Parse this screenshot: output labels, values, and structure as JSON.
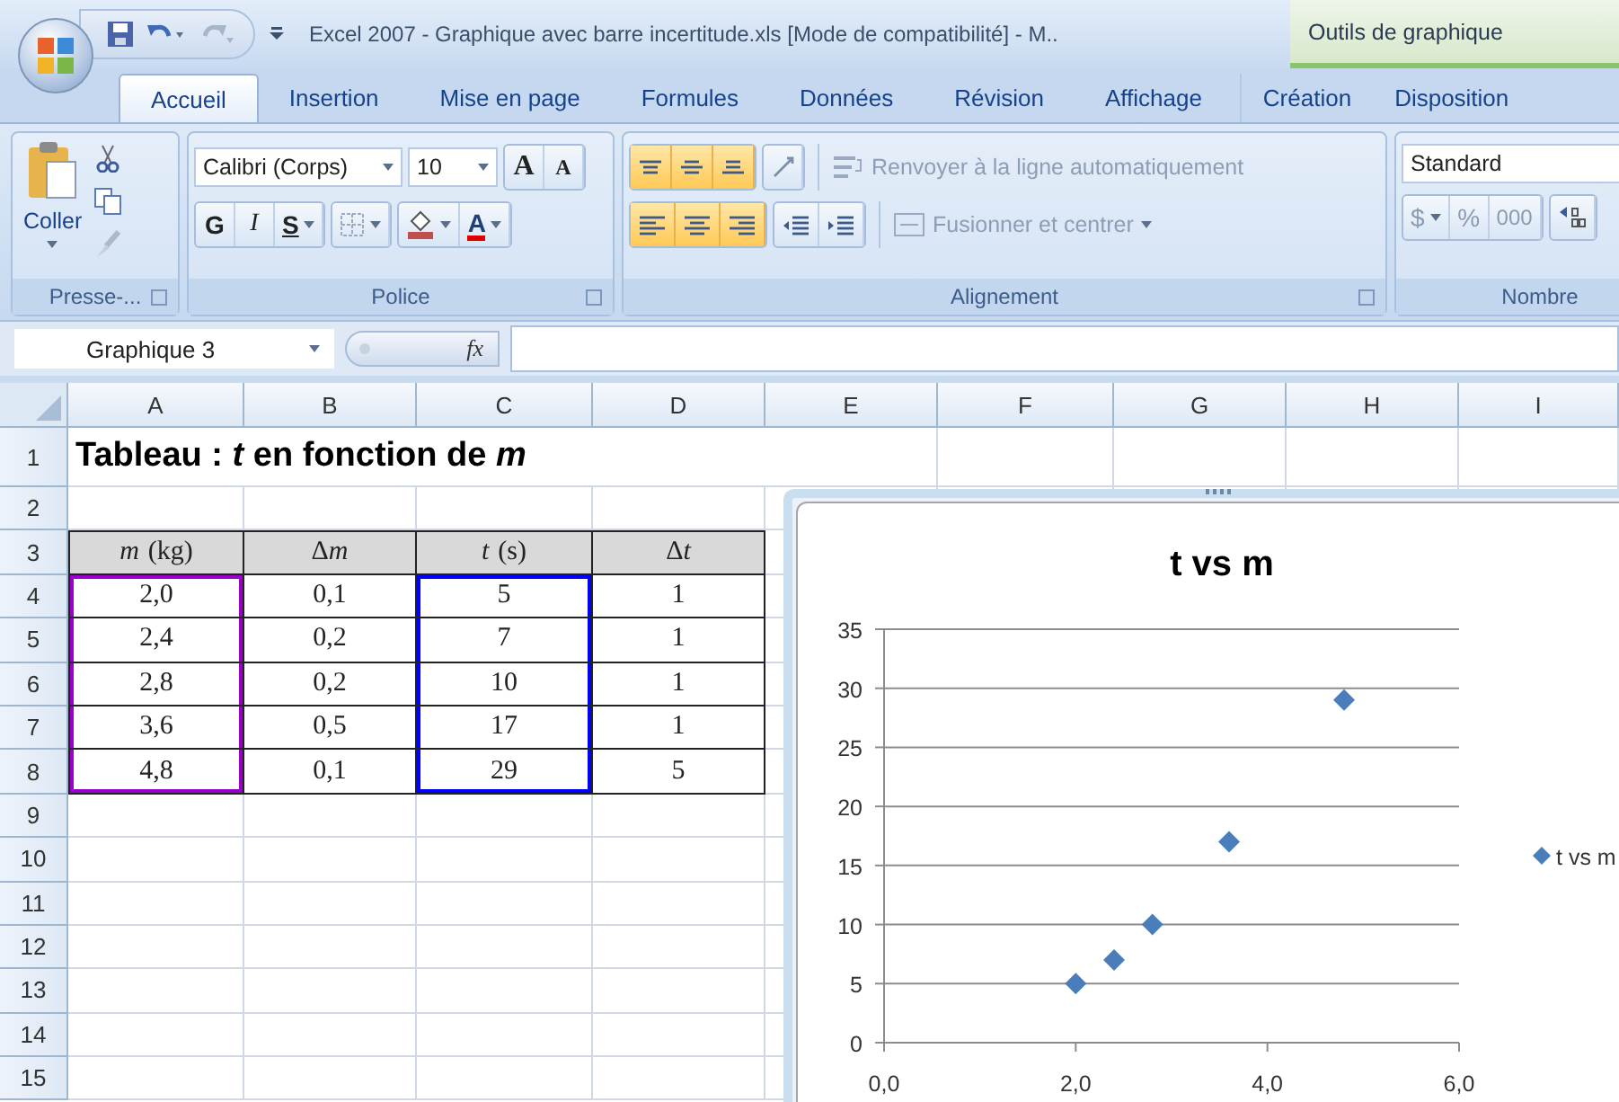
{
  "title_bar": {
    "title": "Excel 2007 - Graphique avec barre incertitude.xls  [Mode de compatibilité] - M..",
    "contextual_label": "Outils de graphique"
  },
  "tabs": [
    {
      "label": "Accueil",
      "selected": true,
      "kind": "main"
    },
    {
      "label": "Insertion",
      "selected": false,
      "kind": "main"
    },
    {
      "label": "Mise en page",
      "selected": false,
      "kind": "main"
    },
    {
      "label": "Formules",
      "selected": false,
      "kind": "main"
    },
    {
      "label": "Données",
      "selected": false,
      "kind": "main"
    },
    {
      "label": "Révision",
      "selected": false,
      "kind": "main"
    },
    {
      "label": "Affichage",
      "selected": false,
      "kind": "main"
    },
    {
      "label": "Création",
      "selected": false,
      "kind": "contextual"
    },
    {
      "label": "Disposition",
      "selected": false,
      "kind": "contextual"
    }
  ],
  "ribbon": {
    "clipboard": {
      "paste_label": "Coller",
      "group_label": "Presse-..."
    },
    "font": {
      "font_name": "Calibri (Corps)",
      "font_size": "10",
      "grow": "A",
      "shrink": "A",
      "bold": "G",
      "italic": "I",
      "underline": "S",
      "font_color": "A",
      "group_label": "Police"
    },
    "alignment": {
      "vertical_buttons": [
        {
          "kind": "top",
          "selected": true
        },
        {
          "kind": "middle",
          "selected": true
        },
        {
          "kind": "bottom",
          "selected": true
        },
        {
          "kind": "orientation",
          "selected": false
        }
      ],
      "horizontal_buttons": [
        {
          "kind": "left",
          "selected": true
        },
        {
          "kind": "center",
          "selected": true
        },
        {
          "kind": "right",
          "selected": true
        },
        {
          "kind": "outdent",
          "selected": false
        },
        {
          "kind": "indent",
          "selected": false
        }
      ],
      "wrap_text": {
        "label": "Renvoyer à la ligne automatiquement",
        "disabled": true
      },
      "merge": {
        "label": "Fusionner et centrer",
        "disabled": true
      },
      "group_label": "Alignement"
    },
    "number": {
      "format": "Standard",
      "currency": "$",
      "percent": "%",
      "thousands": "000",
      "group_label": "Nombre"
    }
  },
  "formula_bar": {
    "name_box": "Graphique 3",
    "function_symbol": "fx"
  },
  "sheet": {
    "columns": [
      "A",
      "B",
      "C",
      "D",
      "E",
      "F",
      "G",
      "H",
      "I"
    ],
    "rows": [
      {
        "number": "1",
        "kind": "title",
        "text": "Tableau : *t*  en fonction de *m*"
      },
      {
        "number": "2",
        "kind": "empty"
      },
      {
        "number": "3",
        "kind": "header",
        "cells": [
          {
            "variable": "m",
            "unit": "(kg)",
            "color": "#9900cc"
          },
          {
            "prefix": "Δ",
            "variable": "m"
          },
          {
            "variable": "t",
            "unit": "(s)",
            "color": "#0000ff"
          },
          {
            "prefix": "Δ",
            "variable": "t"
          }
        ]
      },
      {
        "number": "4",
        "kind": "data",
        "cells": [
          "2,0",
          "0,1",
          "5",
          "1"
        ]
      },
      {
        "number": "5",
        "kind": "data",
        "cells": [
          "2,4",
          "0,2",
          "7",
          "1"
        ]
      },
      {
        "number": "6",
        "kind": "data",
        "cells": [
          "2,8",
          "0,2",
          "10",
          "1"
        ]
      },
      {
        "number": "7",
        "kind": "data",
        "cells": [
          "3,6",
          "0,5",
          "17",
          "1"
        ]
      },
      {
        "number": "8",
        "kind": "data",
        "cells": [
          "4,8",
          "0,1",
          "29",
          "5"
        ]
      },
      {
        "number": "9",
        "kind": "empty"
      },
      {
        "number": "10",
        "kind": "empty"
      },
      {
        "number": "11",
        "kind": "empty"
      },
      {
        "number": "12",
        "kind": "empty"
      },
      {
        "number": "13",
        "kind": "empty"
      },
      {
        "number": "14",
        "kind": "empty"
      },
      {
        "number": "15",
        "kind": "empty"
      }
    ],
    "chart": {
      "chart_data": {
        "type": "scatter",
        "title": "t vs m",
        "x": [
          2.0,
          2.4,
          2.8,
          3.6,
          4.8
        ],
        "series": [
          {
            "name": "t vs m",
            "color": "#4a7ebb",
            "values": [
              5,
              7,
              10,
              17,
              29
            ]
          }
        ],
        "xlim": [
          0,
          6
        ],
        "ylim": [
          0,
          35
        ],
        "xticks": [
          {
            "value": 0,
            "label": "0,0"
          },
          {
            "value": 2,
            "label": "2,0"
          },
          {
            "value": 4,
            "label": "4,0"
          },
          {
            "value": 6,
            "label": "6,0"
          }
        ],
        "yticks": [
          {
            "value": 0,
            "label": "0"
          },
          {
            "value": 5,
            "label": "5"
          },
          {
            "value": 10,
            "label": "10"
          },
          {
            "value": 15,
            "label": "15"
          },
          {
            "value": 20,
            "label": "20"
          },
          {
            "value": 25,
            "label": "25"
          },
          {
            "value": 30,
            "label": "30"
          },
          {
            "value": 35,
            "label": "35"
          }
        ],
        "grid": true
      }
    }
  }
}
